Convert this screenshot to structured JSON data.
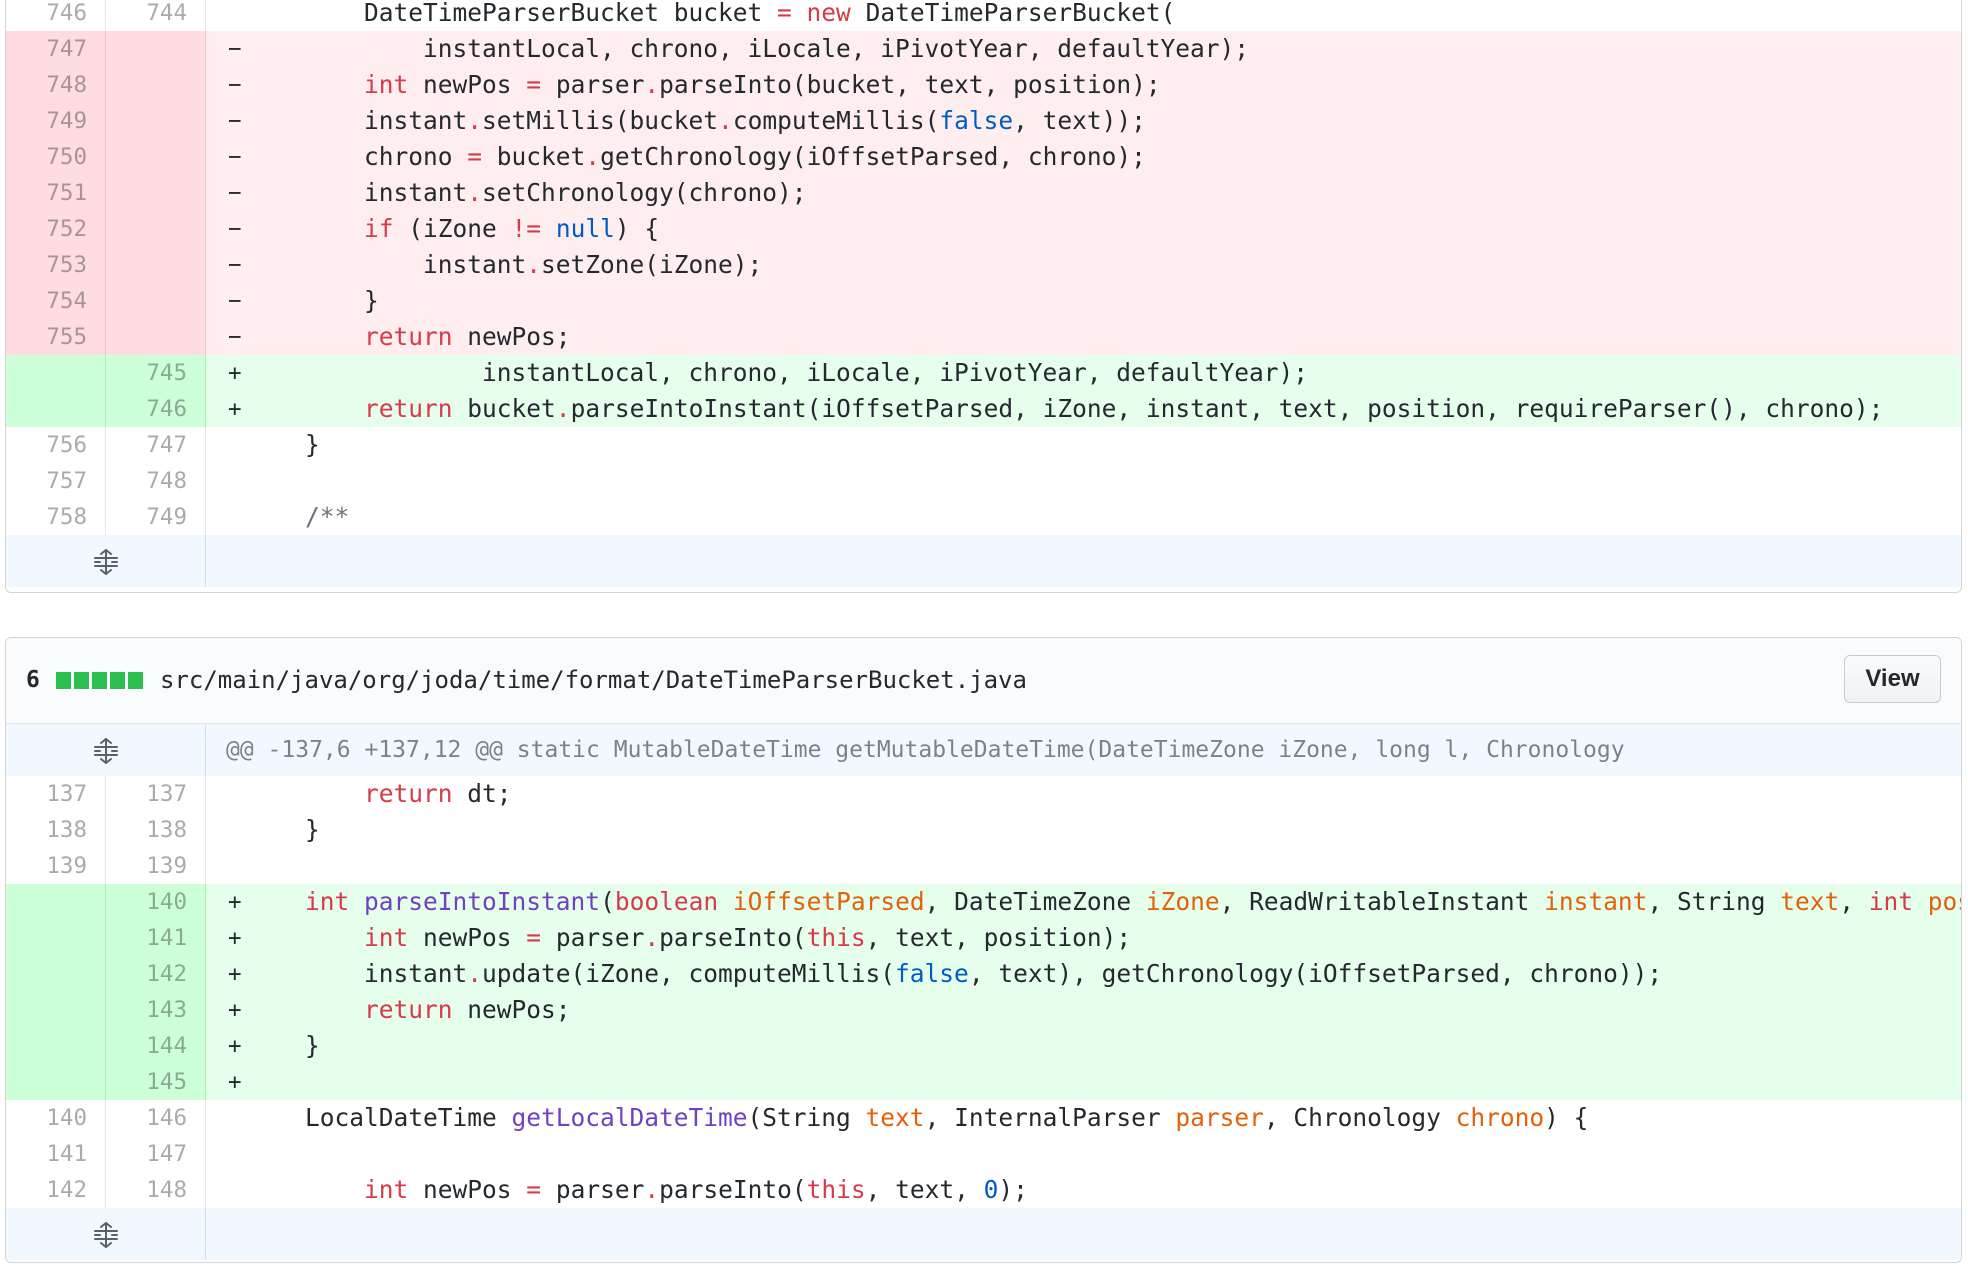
{
  "file1": {
    "rows": [
      {
        "type": "ctx",
        "old": "746",
        "new": "744",
        "marker": "",
        "tokens": [
          {
            "t": "        DateTimeParserBucket bucket "
          },
          {
            "t": "=",
            "c": "k"
          },
          {
            "t": " "
          },
          {
            "t": "new",
            "c": "k"
          },
          {
            "t": " DateTimeParserBucket("
          }
        ]
      },
      {
        "type": "del",
        "old": "747",
        "new": "",
        "marker": "−",
        "tokens": [
          {
            "t": "            instantLocal, chrono, iLocale, iPivotYear, defaultYear);"
          }
        ]
      },
      {
        "type": "del",
        "old": "748",
        "new": "",
        "marker": "−",
        "tokens": [
          {
            "t": "        "
          },
          {
            "t": "int",
            "c": "k"
          },
          {
            "t": " newPos "
          },
          {
            "t": "=",
            "c": "k"
          },
          {
            "t": " parser"
          },
          {
            "t": ".",
            "c": "k"
          },
          {
            "t": "parseInto(bucket, text, position);"
          }
        ]
      },
      {
        "type": "del",
        "old": "749",
        "new": "",
        "marker": "−",
        "tokens": [
          {
            "t": "        instant"
          },
          {
            "t": ".",
            "c": "k"
          },
          {
            "t": "setMillis(bucket"
          },
          {
            "t": ".",
            "c": "k"
          },
          {
            "t": "computeMillis("
          },
          {
            "t": "false",
            "c": "b"
          },
          {
            "t": ", text));"
          }
        ]
      },
      {
        "type": "del",
        "old": "750",
        "new": "",
        "marker": "−",
        "tokens": [
          {
            "t": "        chrono "
          },
          {
            "t": "=",
            "c": "k"
          },
          {
            "t": " bucket"
          },
          {
            "t": ".",
            "c": "k"
          },
          {
            "t": "getChronology(iOffsetParsed, chrono);"
          }
        ]
      },
      {
        "type": "del",
        "old": "751",
        "new": "",
        "marker": "−",
        "tokens": [
          {
            "t": "        instant"
          },
          {
            "t": ".",
            "c": "k"
          },
          {
            "t": "setChronology(chrono);"
          }
        ]
      },
      {
        "type": "del",
        "old": "752",
        "new": "",
        "marker": "−",
        "tokens": [
          {
            "t": "        "
          },
          {
            "t": "if",
            "c": "k"
          },
          {
            "t": " (iZone "
          },
          {
            "t": "!=",
            "c": "k"
          },
          {
            "t": " "
          },
          {
            "t": "null",
            "c": "b"
          },
          {
            "t": ") {"
          }
        ]
      },
      {
        "type": "del",
        "old": "753",
        "new": "",
        "marker": "−",
        "tokens": [
          {
            "t": "            instant"
          },
          {
            "t": ".",
            "c": "k"
          },
          {
            "t": "setZone(iZone);"
          }
        ]
      },
      {
        "type": "del",
        "old": "754",
        "new": "",
        "marker": "−",
        "tokens": [
          {
            "t": "        }"
          }
        ]
      },
      {
        "type": "del",
        "old": "755",
        "new": "",
        "marker": "−",
        "tokens": [
          {
            "t": "        "
          },
          {
            "t": "return",
            "c": "k"
          },
          {
            "t": " newPos;"
          }
        ]
      },
      {
        "type": "add",
        "old": "",
        "new": "745",
        "marker": "+",
        "tokens": [
          {
            "t": "                instantLocal, chrono, iLocale, iPivotYear, defaultYear);"
          }
        ]
      },
      {
        "type": "add",
        "old": "",
        "new": "746",
        "marker": "+",
        "tokens": [
          {
            "t": "        "
          },
          {
            "t": "return",
            "c": "k"
          },
          {
            "t": " bucket"
          },
          {
            "t": ".",
            "c": "k"
          },
          {
            "t": "parseIntoInstant(iOffsetParsed, iZone, instant, text, position, requireParser(), chrono);"
          }
        ]
      },
      {
        "type": "ctx",
        "old": "756",
        "new": "747",
        "marker": "",
        "tokens": [
          {
            "t": "    }"
          }
        ]
      },
      {
        "type": "ctx",
        "old": "757",
        "new": "748",
        "marker": "",
        "tokens": [
          {
            "t": ""
          }
        ]
      },
      {
        "type": "ctx",
        "old": "758",
        "new": "749",
        "marker": "",
        "tokens": [
          {
            "t": "    "
          },
          {
            "t": "/**",
            "c": "c"
          }
        ]
      }
    ]
  },
  "file2": {
    "header": {
      "count": "6",
      "path": "src/main/java/org/joda/time/format/DateTimeParserBucket.java",
      "view_label": "View"
    },
    "hunk": "@@ -137,6 +137,12 @@ static MutableDateTime getMutableDateTime(DateTimeZone iZone, long l, Chronology",
    "rows": [
      {
        "type": "ctx",
        "old": "137",
        "new": "137",
        "marker": "",
        "tokens": [
          {
            "t": "        "
          },
          {
            "t": "return",
            "c": "k"
          },
          {
            "t": " dt;"
          }
        ]
      },
      {
        "type": "ctx",
        "old": "138",
        "new": "138",
        "marker": "",
        "tokens": [
          {
            "t": "    }"
          }
        ]
      },
      {
        "type": "ctx",
        "old": "139",
        "new": "139",
        "marker": "",
        "tokens": [
          {
            "t": ""
          }
        ]
      },
      {
        "type": "add",
        "old": "",
        "new": "140",
        "marker": "+",
        "tokens": [
          {
            "t": "    "
          },
          {
            "t": "int",
            "c": "k"
          },
          {
            "t": " "
          },
          {
            "t": "parseIntoInstant",
            "c": "f"
          },
          {
            "t": "("
          },
          {
            "t": "boolean",
            "c": "k"
          },
          {
            "t": " "
          },
          {
            "t": "iOffsetParsed",
            "c": "v"
          },
          {
            "t": ", DateTimeZone "
          },
          {
            "t": "iZone",
            "c": "v"
          },
          {
            "t": ", ReadWritableInstant "
          },
          {
            "t": "instant",
            "c": "v"
          },
          {
            "t": ", String "
          },
          {
            "t": "text",
            "c": "v"
          },
          {
            "t": ", "
          },
          {
            "t": "int",
            "c": "k"
          },
          {
            "t": " "
          },
          {
            "t": "posit",
            "c": "v"
          }
        ]
      },
      {
        "type": "add",
        "old": "",
        "new": "141",
        "marker": "+",
        "tokens": [
          {
            "t": "        "
          },
          {
            "t": "int",
            "c": "k"
          },
          {
            "t": " newPos "
          },
          {
            "t": "=",
            "c": "k"
          },
          {
            "t": " parser"
          },
          {
            "t": ".",
            "c": "k"
          },
          {
            "t": "parseInto("
          },
          {
            "t": "this",
            "c": "k"
          },
          {
            "t": ", text, position);"
          }
        ]
      },
      {
        "type": "add",
        "old": "",
        "new": "142",
        "marker": "+",
        "tokens": [
          {
            "t": "        instant"
          },
          {
            "t": ".",
            "c": "k"
          },
          {
            "t": "update(iZone, computeMillis("
          },
          {
            "t": "false",
            "c": "b"
          },
          {
            "t": ", text), getChronology(iOffsetParsed, chrono));"
          }
        ]
      },
      {
        "type": "add",
        "old": "",
        "new": "143",
        "marker": "+",
        "tokens": [
          {
            "t": "        "
          },
          {
            "t": "return",
            "c": "k"
          },
          {
            "t": " newPos;"
          }
        ]
      },
      {
        "type": "add",
        "old": "",
        "new": "144",
        "marker": "+",
        "tokens": [
          {
            "t": "    }"
          }
        ]
      },
      {
        "type": "add",
        "old": "",
        "new": "145",
        "marker": "+",
        "tokens": [
          {
            "t": ""
          }
        ]
      },
      {
        "type": "ctx",
        "old": "140",
        "new": "146",
        "marker": "",
        "tokens": [
          {
            "t": "    LocalDateTime "
          },
          {
            "t": "getLocalDateTime",
            "c": "f"
          },
          {
            "t": "(String "
          },
          {
            "t": "text",
            "c": "v"
          },
          {
            "t": ", InternalParser "
          },
          {
            "t": "parser",
            "c": "v"
          },
          {
            "t": ", Chronology "
          },
          {
            "t": "chrono",
            "c": "v"
          },
          {
            "t": ") {"
          }
        ]
      },
      {
        "type": "ctx",
        "old": "141",
        "new": "147",
        "marker": "",
        "tokens": [
          {
            "t": ""
          }
        ]
      },
      {
        "type": "ctx",
        "old": "142",
        "new": "148",
        "marker": "",
        "tokens": [
          {
            "t": "        "
          },
          {
            "t": "int",
            "c": "k"
          },
          {
            "t": " newPos "
          },
          {
            "t": "=",
            "c": "k"
          },
          {
            "t": " parser"
          },
          {
            "t": ".",
            "c": "k"
          },
          {
            "t": "parseInto("
          },
          {
            "t": "this",
            "c": "k"
          },
          {
            "t": ", text, "
          },
          {
            "t": "0",
            "c": "b"
          },
          {
            "t": ");"
          }
        ]
      }
    ]
  },
  "icons": {
    "expand": "unfold-icon"
  },
  "colors": {
    "deletion_bg": "#ffeef0",
    "deletion_gutter": "#ffdce0",
    "addition_bg": "#e6ffed",
    "addition_gutter": "#cdffd8",
    "diffstat_green": "#2cbe4e",
    "expander_bg": "#f1f8ff"
  }
}
